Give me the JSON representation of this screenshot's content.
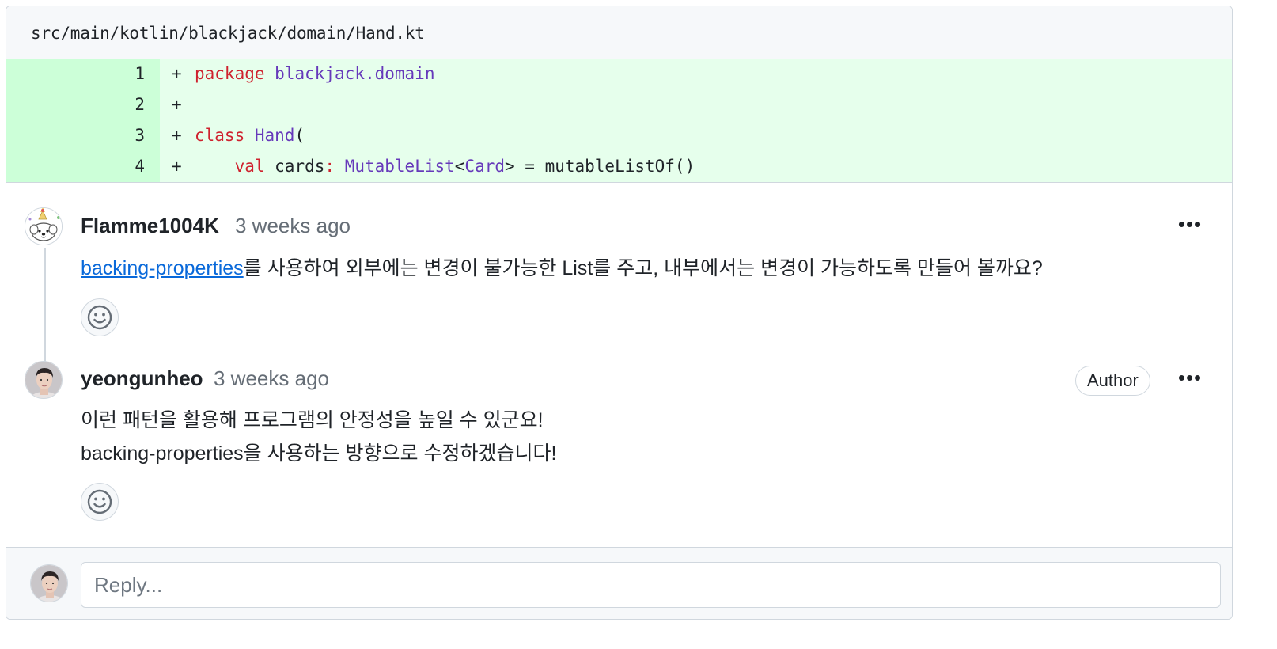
{
  "file": {
    "path": "src/main/kotlin/blackjack/domain/Hand.kt"
  },
  "code": {
    "lines": [
      {
        "number": "1",
        "sign": "+",
        "kw": "package",
        "rest": " ",
        "ty": "blackjack.domain",
        "tail": ""
      },
      {
        "number": "2",
        "sign": "+"
      },
      {
        "number": "3",
        "sign": "+",
        "kw": "class",
        "rest": " ",
        "ty": "Hand",
        "tail": "("
      },
      {
        "number": "4",
        "sign": "+",
        "indent": "    ",
        "kw": "val",
        "name": " cards",
        "colon": ":",
        "type1": "MutableList",
        "lt": "<",
        "type2": "Card",
        "tail": "> = mutableListOf()"
      }
    ]
  },
  "comments": [
    {
      "author": "Flamme1004K",
      "time": "3 weeks ago",
      "link_text": "backing-properties",
      "body": "를 사용하여 외부에는 변경이 불가능한 List를 주고, 내부에서는 변경이 가능하도록 만들어 볼까요?",
      "more_label": "•••",
      "avatar_icon": "party-dog-avatar"
    },
    {
      "author": "yeongunheo",
      "time": "3 weeks ago",
      "badge": "Author",
      "body_line1": "이런 패턴을 활용해 프로그램의 안정성을 높일 수 있군요!",
      "body_line2": "backing-properties을 사용하는 방향으로 수정하겠습니다!",
      "more_label": "•••",
      "avatar_icon": "person-avatar"
    }
  ],
  "reply": {
    "placeholder": "Reply..."
  },
  "colors": {
    "added_bg": "#e6ffec",
    "added_gutter": "#ccffd8",
    "link": "#0969da",
    "keyword": "#cf222e",
    "type": "#6639ba"
  }
}
